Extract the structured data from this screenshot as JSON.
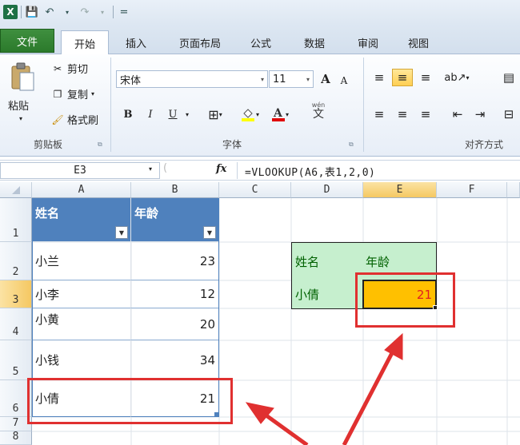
{
  "qat": {
    "logo": "X",
    "save": "💾",
    "undo": "↶",
    "redo": "↷",
    "customize": "="
  },
  "tabs": [
    "文件",
    "开始",
    "插入",
    "页面布局",
    "公式",
    "数据",
    "审阅",
    "视图"
  ],
  "clipboard": {
    "paste": "粘贴",
    "cut": "剪切",
    "copy": "复制",
    "painter": "格式刷",
    "group": "剪贴板"
  },
  "font": {
    "name": "宋体",
    "size": "11",
    "bold": "B",
    "italic": "I",
    "underline": "U",
    "group": "字体",
    "grow": "A",
    "shrink": "A",
    "phonetic": "wén"
  },
  "align": {
    "group": "对齐方式"
  },
  "formula_bar": {
    "name_box": "E3",
    "fx": "fx",
    "formula": "=VLOOKUP(A6,表1,2,0)"
  },
  "columns": [
    "A",
    "B",
    "C",
    "D",
    "E",
    "F"
  ],
  "rows": [
    "1",
    "2",
    "3",
    "4",
    "5",
    "6",
    "7",
    "8"
  ],
  "table": {
    "headers": [
      "姓名",
      "年龄"
    ],
    "rows": [
      [
        "小兰",
        "23"
      ],
      [
        "小李",
        "12"
      ],
      [
        "小黄",
        "20"
      ],
      [
        "小钱",
        "34"
      ],
      [
        "小倩",
        "21"
      ]
    ]
  },
  "lookup": {
    "label_name": "姓名",
    "label_age": "年龄",
    "key": "小倩",
    "result": "21"
  },
  "colors": {
    "table_header": "#4f81bd",
    "green_fill": "#c6efce",
    "result_fill": "#ffc000",
    "highlight": "#e03030"
  }
}
